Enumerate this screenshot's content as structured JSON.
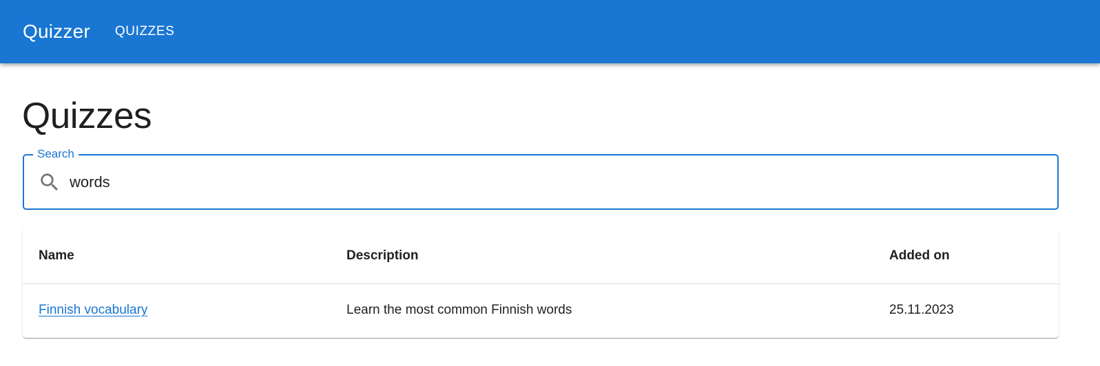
{
  "appbar": {
    "brand": "Quizzer",
    "nav": [
      {
        "label": "QUIZZES"
      }
    ],
    "color": "#1976d2"
  },
  "page": {
    "title": "Quizzes"
  },
  "search": {
    "label": "Search",
    "value": "words",
    "placeholder": "",
    "icon": "search-icon"
  },
  "table": {
    "headers": [
      "Name",
      "Description",
      "Added on"
    ],
    "rows": [
      {
        "name": "Finnish vocabulary",
        "description": "Learn the most common Finnish words",
        "added_on": "25.11.2023"
      }
    ]
  }
}
